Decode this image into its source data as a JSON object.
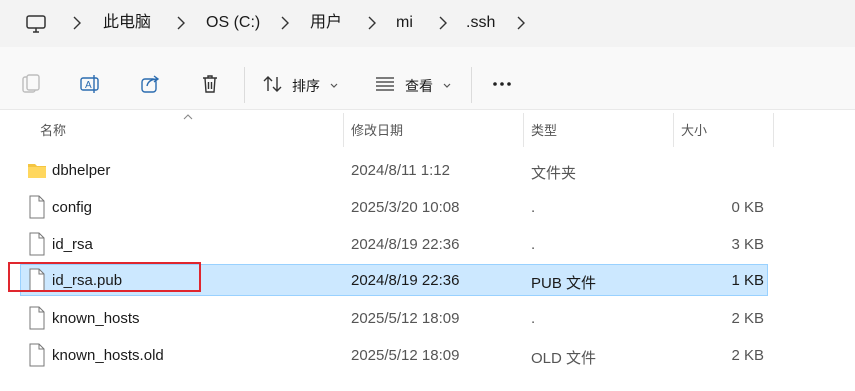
{
  "breadcrumb": [
    "此电脑",
    "OS (C:)",
    "用户",
    "mi",
    ".ssh"
  ],
  "toolbar": {
    "sort_label": "排序",
    "view_label": "查看",
    "more_label": "..."
  },
  "columns": {
    "name": "名称",
    "date": "修改日期",
    "type": "类型",
    "size": "大小"
  },
  "files": [
    {
      "name": "dbhelper",
      "date": "2024/8/11 1:12",
      "type": "文件夹",
      "size": "",
      "icon": "folder-icon"
    },
    {
      "name": "config",
      "date": "2025/3/20 10:08",
      "type": ".",
      "size": "0 KB",
      "icon": "file-icon"
    },
    {
      "name": "id_rsa",
      "date": "2024/8/19 22:36",
      "type": ".",
      "size": "3 KB",
      "icon": "file-icon"
    },
    {
      "name": "id_rsa.pub",
      "date": "2024/8/19 22:36",
      "type": "PUB 文件",
      "size": "1 KB",
      "icon": "file-icon",
      "selected": true
    },
    {
      "name": "known_hosts",
      "date": "2025/5/12 18:09",
      "type": ".",
      "size": "2 KB",
      "icon": "file-icon"
    },
    {
      "name": "known_hosts.old",
      "date": "2025/5/12 18:09",
      "type": "OLD 文件",
      "size": "2 KB",
      "icon": "file-icon"
    }
  ],
  "colors": {
    "selection": "#cce8ff",
    "selection_border": "#99d1ff",
    "highlight": "#e0262e",
    "folder": "#f4c542",
    "accent": "#2b6cb0"
  }
}
